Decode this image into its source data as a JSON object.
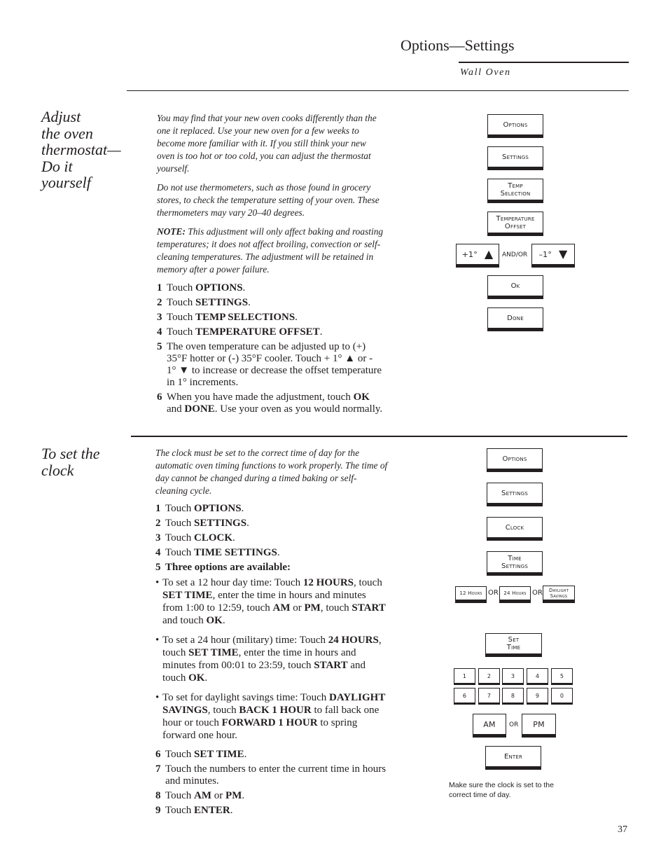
{
  "header": {
    "title": "Options—Settings",
    "subtitle": "Wall Oven"
  },
  "thermostat": {
    "heading_lines": [
      "Adjust",
      "the oven",
      "thermostat—",
      "Do it",
      "yourself"
    ],
    "intro": [
      "You may find that your new oven cooks differently than the one it replaced. Use your new oven for a few weeks to become more familiar with it. If you still think your new oven is too hot or too cold, you can adjust the thermostat yourself.",
      "Do not use thermometers, such as those found in grocery stores, to check the temperature setting of your oven. These thermometers may vary 20–40 degrees."
    ],
    "note_label": "NOTE:",
    "note_text": " This adjustment will only affect baking and roasting temperatures; it does not affect broiling, convection or self-cleaning temperatures. The adjustment will be retained in memory after a power failure.",
    "steps": [
      {
        "num": "1",
        "pre": "Touch ",
        "bold": "OPTIONS",
        "post": "."
      },
      {
        "num": "2",
        "pre": "Touch ",
        "bold": "SETTINGS",
        "post": "."
      },
      {
        "num": "3",
        "pre": "Touch ",
        "bold": "TEMP SELECTIONS",
        "post": "."
      },
      {
        "num": "4",
        "pre": "Touch ",
        "bold": "TEMPERATURE OFFSET",
        "post": "."
      }
    ],
    "step5": {
      "num": "5",
      "text": "The oven temperature can be adjusted up to (+) 35°F hotter or (-) 35°F cooler. Touch + 1° ▲ or - 1° ▼ to increase or decrease the offset temperature in 1° increments."
    },
    "step6": {
      "num": "6",
      "pre": "When you have made the adjustment, touch ",
      "b1": "OK",
      "mid": " and ",
      "b2": "DONE",
      "post": ". Use your oven as you would normally."
    },
    "buttons": {
      "options": "Options",
      "settings": "Settings",
      "temp_selection_1": "Temp",
      "temp_selection_2": "Selection",
      "temp_offset_1": "Temperature",
      "temp_offset_2": "Offset",
      "plus_one": "+1°",
      "andor": "AND/OR",
      "minus_one": "–1°",
      "ok": "Ok",
      "done": "Done"
    }
  },
  "clock": {
    "heading_lines": [
      "To set the",
      "clock"
    ],
    "intro": "The clock must be set to the correct time of day for the automatic oven timing functions to work properly. The time of day cannot be changed during a timed baking or self-cleaning cycle.",
    "steps": [
      {
        "num": "1",
        "pre": "Touch ",
        "bold": "OPTIONS",
        "post": "."
      },
      {
        "num": "2",
        "pre": "Touch ",
        "bold": "SETTINGS",
        "post": "."
      },
      {
        "num": "3",
        "pre": "Touch ",
        "bold": "CLOCK",
        "post": "."
      },
      {
        "num": "4",
        "pre": "Touch ",
        "bold": "TIME SETTINGS",
        "post": "."
      }
    ],
    "step5": {
      "num": "5",
      "text": "Three options are available:"
    },
    "bullets": [
      {
        "segments": [
          {
            "t": "To set a 12 hour day time: Touch ",
            "b": false
          },
          {
            "t": "12 HOURS",
            "b": true
          },
          {
            "t": ", touch ",
            "b": false
          },
          {
            "t": "SET TIME",
            "b": true
          },
          {
            "t": ", enter the time in hours and minutes from 1:00 to 12:59, touch ",
            "b": false
          },
          {
            "t": "AM",
            "b": true
          },
          {
            "t": " or ",
            "b": false
          },
          {
            "t": "PM",
            "b": true
          },
          {
            "t": ", touch ",
            "b": false
          },
          {
            "t": "START",
            "b": true
          },
          {
            "t": " and touch ",
            "b": false
          },
          {
            "t": "OK",
            "b": true
          },
          {
            "t": ".",
            "b": false
          }
        ]
      },
      {
        "segments": [
          {
            "t": "To set a 24 hour (military) time: Touch ",
            "b": false
          },
          {
            "t": "24 HOURS",
            "b": true
          },
          {
            "t": ", touch ",
            "b": false
          },
          {
            "t": "SET TIME",
            "b": true
          },
          {
            "t": ", enter the time in hours and minutes from 00:01 to 23:59, touch ",
            "b": false
          },
          {
            "t": "START",
            "b": true
          },
          {
            "t": " and touch ",
            "b": false
          },
          {
            "t": "OK",
            "b": true
          },
          {
            "t": ".",
            "b": false
          }
        ]
      },
      {
        "segments": [
          {
            "t": "To set for daylight savings time: Touch ",
            "b": false
          },
          {
            "t": "DAYLIGHT SAVINGS",
            "b": true
          },
          {
            "t": ", touch ",
            "b": false
          },
          {
            "t": "BACK 1 HOUR",
            "b": true
          },
          {
            "t": " to fall back one hour or touch ",
            "b": false
          },
          {
            "t": "FORWARD 1 HOUR",
            "b": true
          },
          {
            "t": " to spring forward one hour.",
            "b": false
          }
        ]
      }
    ],
    "steps_after": [
      {
        "num": "6",
        "pre": "Touch ",
        "bold": "SET TIME",
        "post": "."
      },
      {
        "num": "7",
        "pre": "Touch the numbers to enter the current time in hours and minutes.",
        "bold": "",
        "post": ""
      },
      {
        "num": "8",
        "pre": "Touch ",
        "bold": "AM",
        "post": " or ",
        "bold2": "PM",
        "post2": "."
      },
      {
        "num": "9",
        "pre": "Touch ",
        "bold": "ENTER",
        "post": "."
      }
    ],
    "buttons": {
      "options": "Options",
      "settings": "Settings",
      "clock": "Clock",
      "time_settings_1": "Time",
      "time_settings_2": "Settings",
      "hours12": "12 Hours",
      "or": "OR",
      "hours24": "24 Hours",
      "daylight_1": "Daylight",
      "daylight_2": "Savings",
      "set_time_1": "Set",
      "set_time_2": "Time",
      "digits": [
        "1",
        "2",
        "3",
        "4",
        "5",
        "6",
        "7",
        "8",
        "9",
        "0"
      ],
      "am": "AM",
      "pm": "PM",
      "enter": "Enter"
    },
    "caption": "Make sure the clock is set to the correct time of day."
  },
  "page_number": "37"
}
